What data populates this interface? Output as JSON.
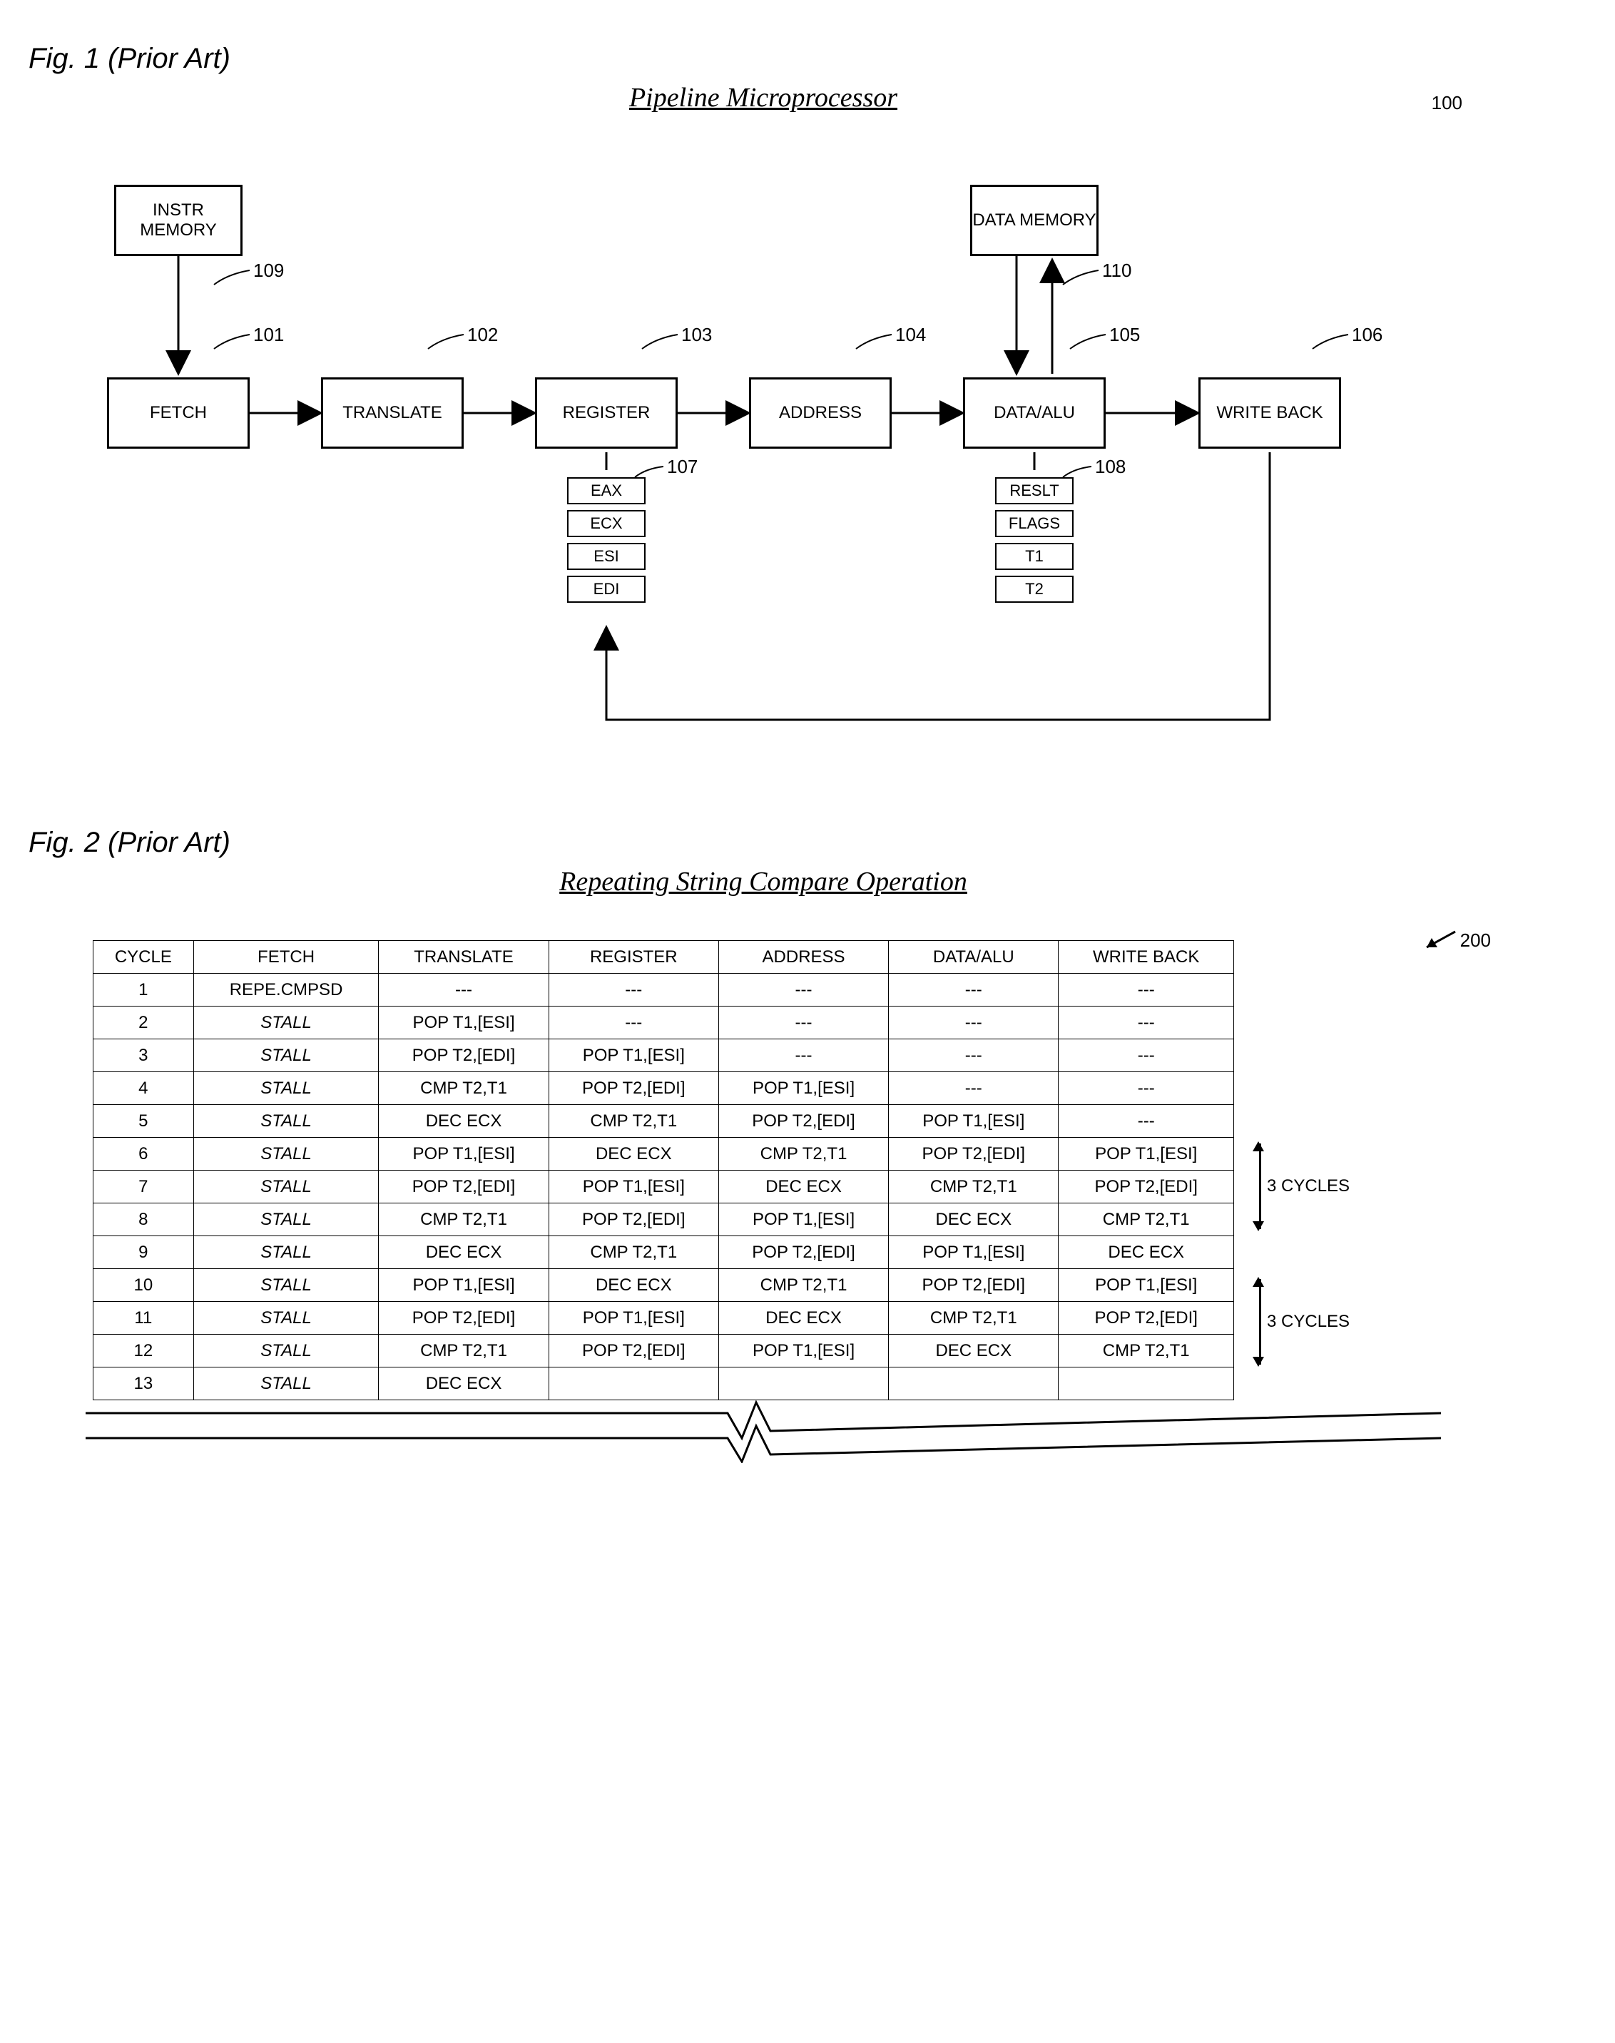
{
  "fig1": {
    "label": "Fig. 1 (Prior Art)",
    "title": "Pipeline Microprocessor",
    "ref100": "100",
    "instrMem": "INSTR MEMORY",
    "dataMem": "DATA MEMORY",
    "stages": {
      "fetch": "FETCH",
      "translate": "TRANSLATE",
      "register": "REGISTER",
      "address": "ADDRESS",
      "dataalu": "DATA/ALU",
      "writeback": "WRITE BACK"
    },
    "refs": {
      "r109": "109",
      "r110": "110",
      "r101": "101",
      "r102": "102",
      "r103": "103",
      "r104": "104",
      "r105": "105",
      "r106": "106",
      "r107": "107",
      "r108": "108"
    },
    "regsLeft": [
      "EAX",
      "ECX",
      "ESI",
      "EDI"
    ],
    "regsRight": [
      "RESLT",
      "FLAGS",
      "T1",
      "T2"
    ]
  },
  "fig2": {
    "label": "Fig. 2 (Prior Art)",
    "title": "Repeating String Compare Operation",
    "ref200": "200",
    "headers": [
      "CYCLE",
      "FETCH",
      "TRANSLATE",
      "REGISTER",
      "ADDRESS",
      "DATA/ALU",
      "WRITE BACK"
    ],
    "sideNote": "3 CYCLES",
    "rows": [
      [
        "1",
        "REPE.CMPSD",
        "---",
        "---",
        "---",
        "---",
        "---"
      ],
      [
        "2",
        "STALL",
        "POP T1,[ESI]",
        "---",
        "---",
        "---",
        "---"
      ],
      [
        "3",
        "STALL",
        "POP T2,[EDI]",
        "POP T1,[ESI]",
        "---",
        "---",
        "---"
      ],
      [
        "4",
        "STALL",
        "CMP T2,T1",
        "POP T2,[EDI]",
        "POP T1,[ESI]",
        "---",
        "---"
      ],
      [
        "5",
        "STALL",
        "DEC ECX",
        "CMP T2,T1",
        "POP T2,[EDI]",
        "POP T1,[ESI]",
        "---"
      ],
      [
        "6",
        "STALL",
        "POP T1,[ESI]",
        "DEC ECX",
        "CMP T2,T1",
        "POP T2,[EDI]",
        "POP T1,[ESI]"
      ],
      [
        "7",
        "STALL",
        "POP T2,[EDI]",
        "POP T1,[ESI]",
        "DEC ECX",
        "CMP T2,T1",
        "POP T2,[EDI]"
      ],
      [
        "8",
        "STALL",
        "CMP T2,T1",
        "POP T2,[EDI]",
        "POP T1,[ESI]",
        "DEC ECX",
        "CMP T2,T1"
      ],
      [
        "9",
        "STALL",
        "DEC ECX",
        "CMP T2,T1",
        "POP T2,[EDI]",
        "POP T1,[ESI]",
        "DEC ECX"
      ],
      [
        "10",
        "STALL",
        "POP T1,[ESI]",
        "DEC ECX",
        "CMP T2,T1",
        "POP T2,[EDI]",
        "POP T1,[ESI]"
      ],
      [
        "11",
        "STALL",
        "POP T2,[EDI]",
        "POP T1,[ESI]",
        "DEC ECX",
        "CMP T2,T1",
        "POP T2,[EDI]"
      ],
      [
        "12",
        "STALL",
        "CMP T2,T1",
        "POP T2,[EDI]",
        "POP T1,[ESI]",
        "DEC ECX",
        "CMP T2,T1"
      ],
      [
        "13",
        "STALL",
        "DEC ECX",
        "",
        "",
        "",
        ""
      ]
    ]
  }
}
